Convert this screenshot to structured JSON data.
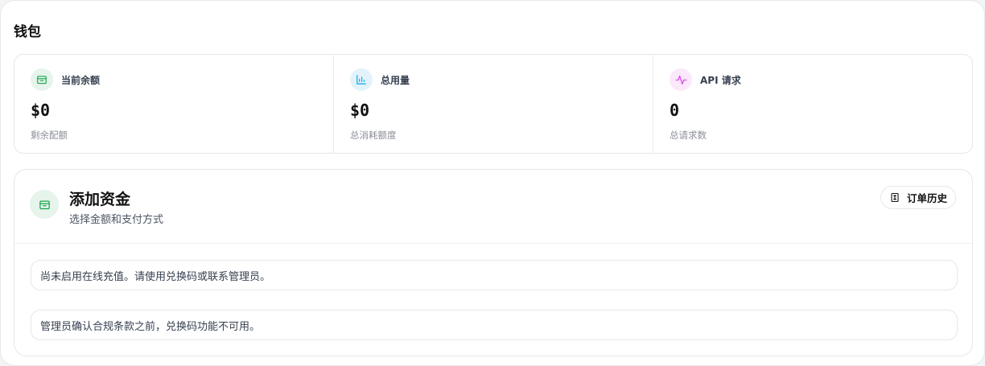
{
  "page": {
    "title": "钱包"
  },
  "stats": [
    {
      "label": "当前余额",
      "value": "$0",
      "sub": "剩余配额",
      "icon": "wallet-icon",
      "color": "#16a34a",
      "bg": "#e6f4ec"
    },
    {
      "label": "总用量",
      "value": "$0",
      "sub": "总消耗额度",
      "icon": "bar-chart-icon",
      "color": "#0ea5e9",
      "bg": "#e3f3fb"
    },
    {
      "label": "API 请求",
      "value": "0",
      "sub": "总请求数",
      "icon": "activity-icon",
      "color": "#d946ef",
      "bg": "#fbe8fb"
    }
  ],
  "fund": {
    "title": "添加资金",
    "subtitle": "选择金额和支付方式",
    "icon": "wallet-icon",
    "order_history_label": "订单历史",
    "order_history_icon": "receipt-icon",
    "notices": [
      "尚未启用在线充值。请使用兑换码或联系管理员。",
      "管理员确认合规条款之前，兑换码功能不可用。"
    ]
  }
}
